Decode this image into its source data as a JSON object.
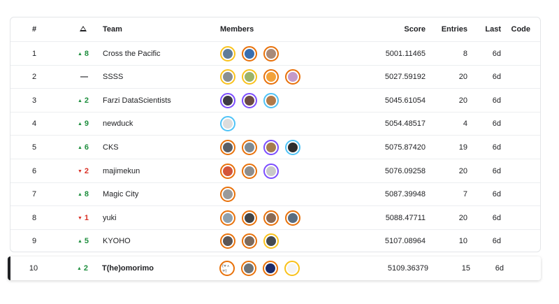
{
  "headers": {
    "rank": "#",
    "team": "Team",
    "members": "Members",
    "score": "Score",
    "entries": "Entries",
    "last": "Last",
    "code": "Code"
  },
  "colors": {
    "up": "#1e8e3e",
    "down": "#d93025",
    "ring_orange": "#e8710a",
    "ring_yellow": "#f9c21b",
    "ring_blue": "#4fc3f7",
    "ring_purple": "#7c4dff"
  },
  "rows": [
    {
      "rank": "1",
      "trend": "up",
      "delta": "8",
      "team": "Cross the Pacific",
      "score": "5001.11465",
      "entries": "8",
      "last": "6d",
      "avatars": [
        {
          "ring": "yellow",
          "fill": "#5f7d99"
        },
        {
          "ring": "orange",
          "fill": "#3a6fb0"
        },
        {
          "ring": "orange",
          "fill": "#a88a7a"
        }
      ]
    },
    {
      "rank": "2",
      "trend": "flat",
      "delta": "—",
      "team": "SSSS",
      "score": "5027.59192",
      "entries": "20",
      "last": "6d",
      "avatars": [
        {
          "ring": "yellow",
          "fill": "#8a8f93"
        },
        {
          "ring": "yellow",
          "fill": "#9bb36a"
        },
        {
          "ring": "orange",
          "fill": "#f2a23a"
        },
        {
          "ring": "orange",
          "fill": "#c49ac9"
        }
      ]
    },
    {
      "rank": "3",
      "trend": "up",
      "delta": "2",
      "team": "Farzi DataScientists",
      "score": "5045.61054",
      "entries": "20",
      "last": "6d",
      "avatars": [
        {
          "ring": "purple",
          "fill": "#3d3b44"
        },
        {
          "ring": "purple",
          "fill": "#6b4b45"
        },
        {
          "ring": "blue",
          "fill": "#b07a4a"
        }
      ]
    },
    {
      "rank": "4",
      "trend": "up",
      "delta": "9",
      "team": "newduck",
      "score": "5054.48517",
      "entries": "4",
      "last": "6d",
      "avatars": [
        {
          "ring": "blue",
          "fill": "#dcdcdc"
        }
      ]
    },
    {
      "rank": "5",
      "trend": "up",
      "delta": "6",
      "team": "CKS",
      "score": "5075.87420",
      "entries": "19",
      "last": "6d",
      "avatars": [
        {
          "ring": "orange",
          "fill": "#5b5f66"
        },
        {
          "ring": "orange",
          "fill": "#7d8a94"
        },
        {
          "ring": "purple",
          "fill": "#a67c4e"
        },
        {
          "ring": "blue",
          "fill": "#2e2e2e"
        }
      ]
    },
    {
      "rank": "6",
      "trend": "down",
      "delta": "2",
      "team": "majimekun",
      "score": "5076.09258",
      "entries": "20",
      "last": "6d",
      "avatars": [
        {
          "ring": "orange",
          "fill": "#d3553a"
        },
        {
          "ring": "orange",
          "fill": "#8d8d8d"
        },
        {
          "ring": "purple",
          "fill": "#c8c8c8"
        }
      ]
    },
    {
      "rank": "7",
      "trend": "up",
      "delta": "8",
      "team": "Magic City",
      "score": "5087.39948",
      "entries": "7",
      "last": "6d",
      "avatars": [
        {
          "ring": "orange",
          "fill": "#9a9a9a"
        }
      ]
    },
    {
      "rank": "8",
      "trend": "down",
      "delta": "1",
      "team": "yuki",
      "score": "5088.47711",
      "entries": "20",
      "last": "6d",
      "avatars": [
        {
          "ring": "orange",
          "fill": "#8fa0ad"
        },
        {
          "ring": "orange",
          "fill": "#404448"
        },
        {
          "ring": "orange",
          "fill": "#8a6a55"
        },
        {
          "ring": "orange",
          "fill": "#5a6d80"
        }
      ]
    },
    {
      "rank": "9",
      "trend": "up",
      "delta": "5",
      "team": "KYOHO",
      "score": "5107.08964",
      "entries": "10",
      "last": "6d",
      "avatars": [
        {
          "ring": "orange",
          "fill": "#5b5656"
        },
        {
          "ring": "orange",
          "fill": "#7d6a5c"
        },
        {
          "ring": "yellow",
          "fill": "#444a50"
        }
      ]
    }
  ],
  "my_row": {
    "rank": "10",
    "trend": "up",
    "delta": "2",
    "team": "T(he)omorimo",
    "score": "5109.36379",
    "entries": "15",
    "last": "6d",
    "avatars": [
      {
        "ring": "orange",
        "fill": "#ffffff",
        "text": "(ㅠㅅㅠ)"
      },
      {
        "ring": "orange",
        "fill": "#6e7479"
      },
      {
        "ring": "orange",
        "fill": "#1b2a6b"
      },
      {
        "ring": "yellow",
        "fill": "#f4f4f4"
      }
    ]
  }
}
